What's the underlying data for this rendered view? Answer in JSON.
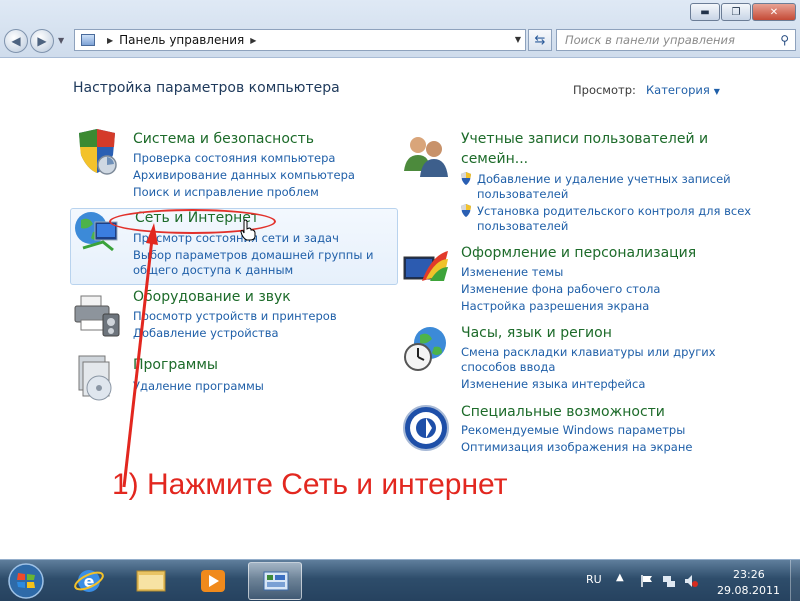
{
  "window": {
    "minimize_glyph": "▬",
    "maximize_glyph": "❐",
    "close_glyph": "✕"
  },
  "addressbar": {
    "crumbs": [
      "Панель управления"
    ],
    "search_placeholder": "Поиск в панели управления"
  },
  "main": {
    "page_title": "Настройка параметров компьютера",
    "view_label": "Просмотр:",
    "view_value": "Категория"
  },
  "categories": {
    "system": {
      "title": "Система и безопасность",
      "links": [
        "Проверка состояния компьютера",
        "Архивирование данных компьютера",
        "Поиск и исправление проблем"
      ]
    },
    "network": {
      "title": "Сеть и Интернет",
      "links": [
        "Просмотр состояния сети и задач",
        "Выбор параметров домашней группы и",
        "общего доступа к данным"
      ]
    },
    "hardware": {
      "title": "Оборудование и звук",
      "links": [
        "Просмотр устройств и принтеров",
        "Добавление устройства"
      ]
    },
    "programs": {
      "title": "Программы",
      "links": [
        "Удаление программы"
      ]
    },
    "accounts": {
      "title_line1": "Учетные записи пользователей и",
      "title_line2": "семейн...",
      "links": [
        "Добавление и удаление учетных записей",
        "пользователей",
        "Установка родительского контроля для всех",
        "пользователей"
      ]
    },
    "appearance": {
      "title": "Оформление и персонализация",
      "links": [
        "Изменение темы",
        "Изменение фона рабочего стола",
        "Настройка разрешения экрана"
      ]
    },
    "clock": {
      "title": "Часы, язык и регион",
      "links": [
        "Смена раскладки клавиатуры или других",
        "способов ввода",
        "Изменение языка интерфейса"
      ]
    },
    "access": {
      "title": "Специальные возможности",
      "links": [
        "Рекомендуемые Windows параметры",
        "Оптимизация изображения на экране"
      ]
    }
  },
  "annotation": {
    "text": "1) Нажмите Сеть и интернет",
    "color": "#e2271f"
  },
  "taskbar": {
    "language": "RU",
    "time": "23:26",
    "date": "29.08.2011"
  },
  "colors": {
    "category_title": "#1d6b2a",
    "link": "#1f5fa8",
    "title": "#1e395b"
  }
}
